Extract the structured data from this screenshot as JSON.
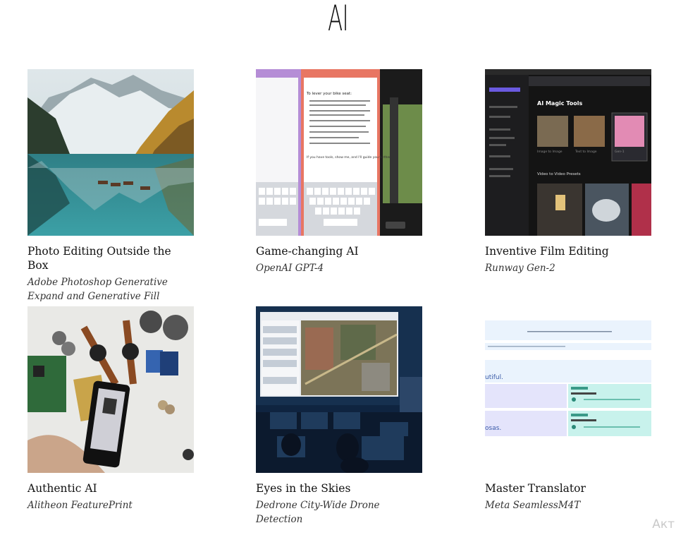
{
  "page": {
    "title": "AI"
  },
  "cards": [
    {
      "title": "Photo Editing Outside the Box",
      "subtitle": "Adobe Photoshop Generative Expand and Generative Fill",
      "image": "mountain-lake-photo"
    },
    {
      "title": "Game-changing AI",
      "subtitle": "OpenAI GPT-4",
      "image": "phone-chat-screens",
      "screen_text": {
        "list_title": "To lever your bike seat:",
        "footer": "If you have tools, show me, and I'll guide you further."
      }
    },
    {
      "title": "Inventive Film Editing",
      "subtitle": "Runway Gen-2",
      "image": "dark-app-interface",
      "screen_text": {
        "heading": "AI Magic Tools",
        "section": "Video to Video Presets",
        "tool_1": "Image to Image",
        "tool_2": "Text to Image",
        "tool_3": "Gen-1"
      }
    },
    {
      "title": "Authentic AI",
      "subtitle": "Alitheon FeaturePrint",
      "image": "watches-gears-phone-photo"
    },
    {
      "title": "Eyes in the Skies",
      "subtitle": "Dedrone City-Wide Drone Detection",
      "image": "control-room-photo"
    },
    {
      "title": "Master Translator",
      "subtitle": "Meta SeamlessM4T",
      "image": "translator-ui",
      "screen_text": {
        "fragment_1": "utiful.",
        "fragment_2": "osas."
      }
    }
  ],
  "watermark": "Акт",
  "colors": {
    "accent_teal": "#c8f2ec",
    "accent_lavender": "#e4e4fb",
    "light_blue": "#eaf3fd"
  }
}
